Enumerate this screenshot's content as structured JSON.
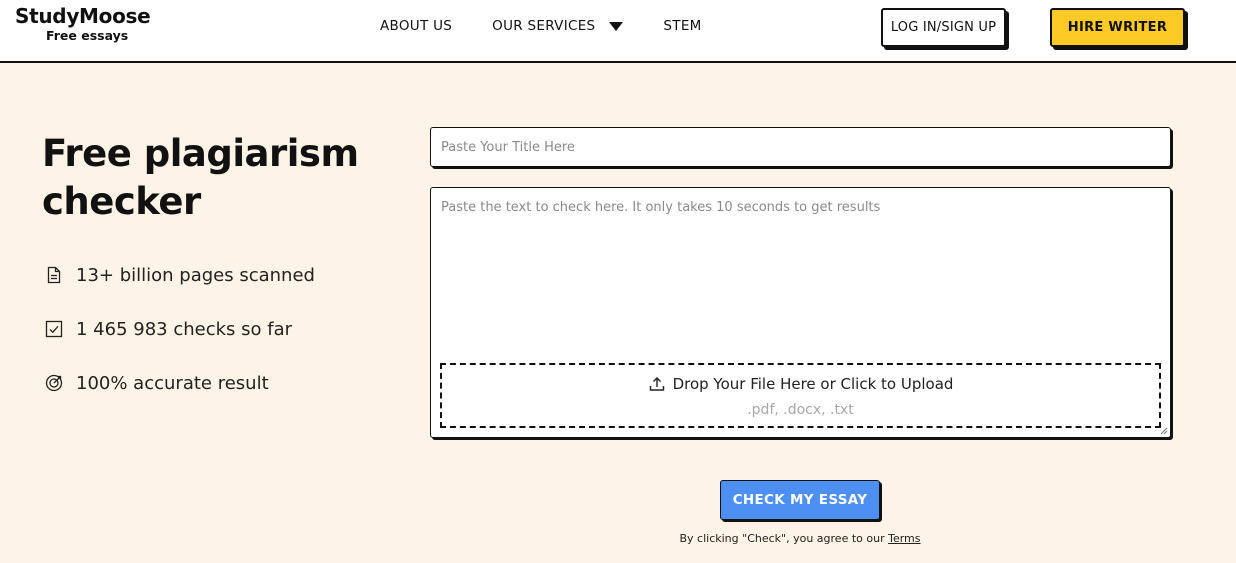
{
  "header": {
    "logo_name": "StudyMoose",
    "logo_tagline": "Free essays",
    "nav": {
      "about": "ABOUT US",
      "services": "OUR SERVICES",
      "stem": "STEM"
    },
    "login_label": "LOG IN/SIGN UP",
    "hire_label": "HIRE WRITER"
  },
  "hero": {
    "title": "Free plagiarism checker",
    "features": [
      {
        "icon": "document-icon",
        "text": "13+ billion pages scanned"
      },
      {
        "icon": "checkbox-icon",
        "text": "1 465 983 checks so far"
      },
      {
        "icon": "target-icon",
        "text": "100% accurate result"
      }
    ]
  },
  "form": {
    "title_placeholder": "Paste Your Title Here",
    "text_placeholder": "Paste the text to check here. It only takes 10 seconds to get results",
    "dropzone_label": "Drop Your File Here or Click to Upload",
    "dropzone_types": ".pdf, .docx, .txt",
    "check_label": "CHECK MY ESSAY",
    "terms_prefix": "By clicking \"Check\", you agree to our ",
    "terms_link": "Terms"
  },
  "colors": {
    "page_background": "#fdf3e6",
    "hire_button": "#ffc926",
    "check_button": "#4d8ff2",
    "border": "#111111"
  }
}
